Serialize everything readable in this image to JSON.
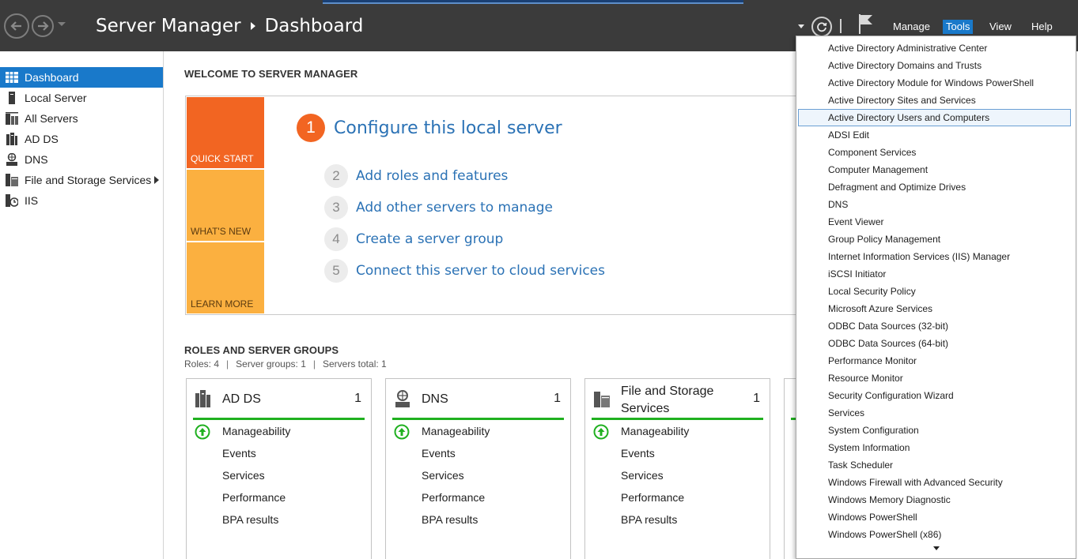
{
  "header": {
    "title": "Server Manager",
    "page": "Dashboard",
    "menus": {
      "manage": "Manage",
      "tools": "Tools",
      "view": "View",
      "help": "Help"
    }
  },
  "sidebar": {
    "items": [
      {
        "label": "Dashboard",
        "icon": "dashboard-icon",
        "active": true
      },
      {
        "label": "Local Server",
        "icon": "local-server-icon"
      },
      {
        "label": "All Servers",
        "icon": "all-servers-icon"
      },
      {
        "label": "AD DS",
        "icon": "adds-icon"
      },
      {
        "label": "DNS",
        "icon": "dns-icon"
      },
      {
        "label": "File and Storage Services",
        "icon": "file-storage-icon",
        "has_submenu": true
      },
      {
        "label": "IIS",
        "icon": "iis-icon"
      }
    ]
  },
  "welcome": {
    "title": "WELCOME TO SERVER MANAGER",
    "tiles": {
      "quick_start": "QUICK START",
      "whats_new": "WHAT'S NEW",
      "learn_more": "LEARN MORE"
    },
    "steps": [
      {
        "num": "1",
        "label": "Configure this local server"
      },
      {
        "num": "2",
        "label": "Add roles and features"
      },
      {
        "num": "3",
        "label": "Add other servers to manage"
      },
      {
        "num": "4",
        "label": "Create a server group"
      },
      {
        "num": "5",
        "label": "Connect this server to cloud services"
      }
    ]
  },
  "roles": {
    "title": "ROLES AND SERVER GROUPS",
    "summary": {
      "roles": "Roles: 4",
      "groups": "Server groups: 1",
      "servers": "Servers total: 1"
    },
    "cards": [
      {
        "title": "AD DS",
        "count": "1",
        "icon": "adds-icon",
        "rows": [
          "Manageability",
          "Events",
          "Services",
          "Performance",
          "BPA results"
        ]
      },
      {
        "title": "DNS",
        "count": "1",
        "icon": "dns-icon",
        "rows": [
          "Manageability",
          "Events",
          "Services",
          "Performance",
          "BPA results"
        ]
      },
      {
        "title": "File and Storage Services",
        "count": "1",
        "icon": "file-storage-icon",
        "rows": [
          "Manageability",
          "Events",
          "Services",
          "Performance",
          "BPA results"
        ]
      }
    ]
  },
  "tools_menu": {
    "hovered_index": 4,
    "items": [
      "Active Directory Administrative Center",
      "Active Directory Domains and Trusts",
      "Active Directory Module for Windows PowerShell",
      "Active Directory Sites and Services",
      "Active Directory Users and Computers",
      "ADSI Edit",
      "Component Services",
      "Computer Management",
      "Defragment and Optimize Drives",
      "DNS",
      "Event Viewer",
      "Group Policy Management",
      "Internet Information Services (IIS) Manager",
      "iSCSI Initiator",
      "Local Security Policy",
      "Microsoft Azure Services",
      "ODBC Data Sources (32-bit)",
      "ODBC Data Sources (64-bit)",
      "Performance Monitor",
      "Resource Monitor",
      "Security Configuration Wizard",
      "Services",
      "System Configuration",
      "System Information",
      "Task Scheduler",
      "Windows Firewall with Advanced Security",
      "Windows Memory Diagnostic",
      "Windows PowerShell",
      "Windows PowerShell (x86)"
    ]
  },
  "colors": {
    "header_bg": "#3b3b3b",
    "accent_blue": "#1979ca",
    "quick_start_orange": "#f26522",
    "tile_yellow": "#fbb040",
    "link_blue": "#2b72b5",
    "status_green": "#20b020"
  }
}
